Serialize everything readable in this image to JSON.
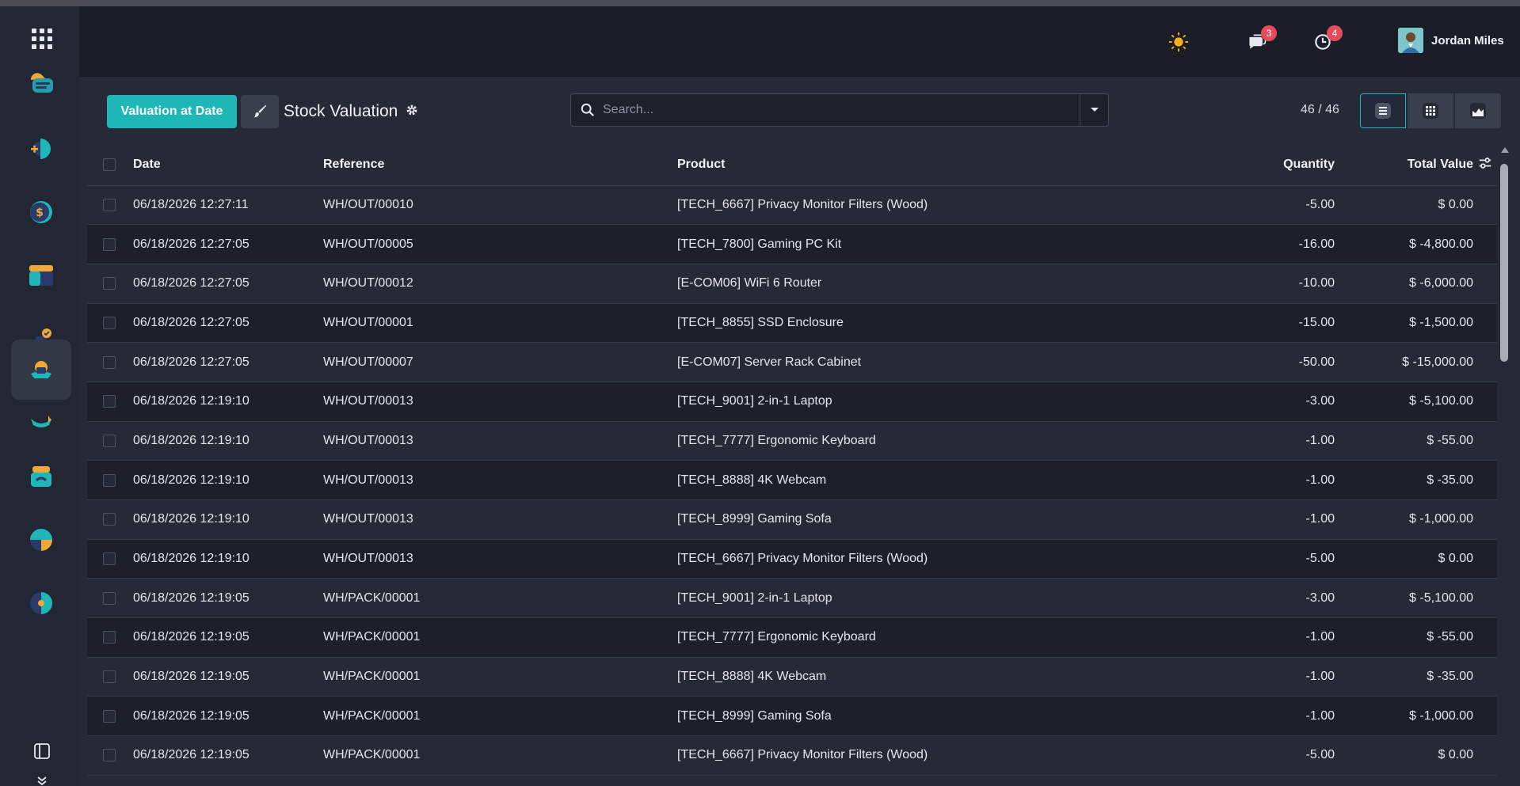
{
  "navbar": {
    "messages_badge": "3",
    "activities_badge": "4",
    "user_name": "Jordan Miles"
  },
  "control_panel": {
    "valuation_button": "Valuation at Date",
    "breadcrumb_title": "Stock Valuation",
    "search_placeholder": "Search...",
    "pager": "46 / 46"
  },
  "table": {
    "headers": {
      "date": "Date",
      "reference": "Reference",
      "product": "Product",
      "quantity": "Quantity",
      "total_value": "Total Value"
    },
    "rows": [
      {
        "date": "06/18/2026 12:27:11",
        "reference": "WH/OUT/00010",
        "product": "[TECH_6667] Privacy Monitor Filters (Wood)",
        "quantity": "-5.00",
        "value": "$ 0.00"
      },
      {
        "date": "06/18/2026 12:27:05",
        "reference": "WH/OUT/00005",
        "product": "[TECH_7800] Gaming PC Kit",
        "quantity": "-16.00",
        "value": "$ -4,800.00"
      },
      {
        "date": "06/18/2026 12:27:05",
        "reference": "WH/OUT/00012",
        "product": "[E-COM06] WiFi 6 Router",
        "quantity": "-10.00",
        "value": "$ -6,000.00"
      },
      {
        "date": "06/18/2026 12:27:05",
        "reference": "WH/OUT/00001",
        "product": "[TECH_8855] SSD Enclosure",
        "quantity": "-15.00",
        "value": "$ -1,500.00"
      },
      {
        "date": "06/18/2026 12:27:05",
        "reference": "WH/OUT/00007",
        "product": "[E-COM07] Server Rack Cabinet",
        "quantity": "-50.00",
        "value": "$ -15,000.00"
      },
      {
        "date": "06/18/2026 12:19:10",
        "reference": "WH/OUT/00013",
        "product": "[TECH_9001] 2-in-1 Laptop",
        "quantity": "-3.00",
        "value": "$ -5,100.00"
      },
      {
        "date": "06/18/2026 12:19:10",
        "reference": "WH/OUT/00013",
        "product": "[TECH_7777] Ergonomic Keyboard",
        "quantity": "-1.00",
        "value": "$ -55.00"
      },
      {
        "date": "06/18/2026 12:19:10",
        "reference": "WH/OUT/00013",
        "product": "[TECH_8888] 4K Webcam",
        "quantity": "-1.00",
        "value": "$ -35.00"
      },
      {
        "date": "06/18/2026 12:19:10",
        "reference": "WH/OUT/00013",
        "product": "[TECH_8999] Gaming Sofa",
        "quantity": "-1.00",
        "value": "$ -1,000.00"
      },
      {
        "date": "06/18/2026 12:19:10",
        "reference": "WH/OUT/00013",
        "product": "[TECH_6667] Privacy Monitor Filters (Wood)",
        "quantity": "-5.00",
        "value": "$ 0.00"
      },
      {
        "date": "06/18/2026 12:19:05",
        "reference": "WH/PACK/00001",
        "product": "[TECH_9001] 2-in-1 Laptop",
        "quantity": "-3.00",
        "value": "$ -5,100.00"
      },
      {
        "date": "06/18/2026 12:19:05",
        "reference": "WH/PACK/00001",
        "product": "[TECH_7777] Ergonomic Keyboard",
        "quantity": "-1.00",
        "value": "$ -55.00"
      },
      {
        "date": "06/18/2026 12:19:05",
        "reference": "WH/PACK/00001",
        "product": "[TECH_8888] 4K Webcam",
        "quantity": "-1.00",
        "value": "$ -35.00"
      },
      {
        "date": "06/18/2026 12:19:05",
        "reference": "WH/PACK/00001",
        "product": "[TECH_8999] Gaming Sofa",
        "quantity": "-1.00",
        "value": "$ -1,000.00"
      },
      {
        "date": "06/18/2026 12:19:05",
        "reference": "WH/PACK/00001",
        "product": "[TECH_6667] Privacy Monitor Filters (Wood)",
        "quantity": "-5.00",
        "value": "$ 0.00"
      }
    ]
  },
  "colors": {
    "accent": "#1fb6b8",
    "badge": "#e54b5a",
    "navbar": "#1b1e29",
    "sidebar": "#232733"
  },
  "icons": [
    "apps-grid-icon",
    "sun-icon",
    "chat-icon",
    "clock-icon",
    "brush-icon",
    "gear-icon",
    "search-icon",
    "caret-down-icon",
    "list-view-icon",
    "pivot-view-icon",
    "graph-view-icon",
    "column-settings-icon",
    "sidebar-toggle-icon",
    "chevron-double-down-icon"
  ]
}
